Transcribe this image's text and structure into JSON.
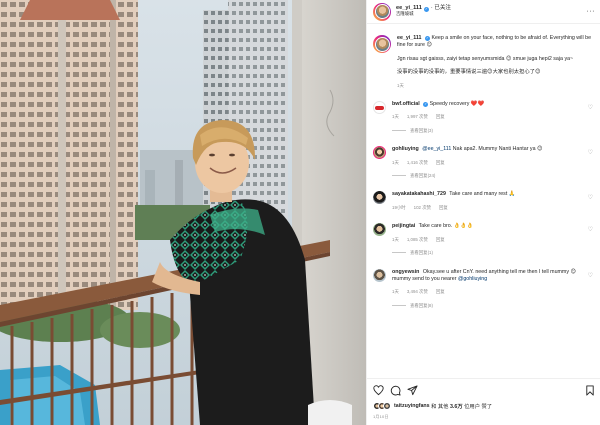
{
  "post": {
    "author": "ee_yi_111",
    "follow_label": "· 已关注",
    "location": "吉隆坡城"
  },
  "caption": {
    "username": "ee_yi_111",
    "text": "Keep a smile on your face, nothing to be afraid of. Everything will be fine for sure 😊",
    "malay": "Jgn risau sgt gaisss, zaiyi tetap senyumsmida 😊 smue juga hepi2 saja ya~",
    "chinese": "没事的没事的没事的，重要事情说三遍😊大家也别太担心了😊",
    "time": "1天"
  },
  "comments": [
    {
      "username": "bwf.official",
      "text": "Speedy recovery ❤️❤️",
      "time": "1天",
      "likes": "1,997 次赞",
      "reply_label": "回复",
      "view_replies": "查看回复(3)"
    },
    {
      "username": "gohliuying",
      "mention": "@ee_yi_111",
      "text": "Nak apa2. Mummy Nanti Hantar ya 😊",
      "time": "1天",
      "likes": "1,416 次赞",
      "reply_label": "回复",
      "view_replies": "查看回复(24)"
    },
    {
      "username": "sayakatakahashi_729",
      "text": "Take care and many rest 🙏",
      "time": "19小时",
      "likes": "102 次赞",
      "reply_label": "回复",
      "view_replies": ""
    },
    {
      "username": "peijingtai",
      "text": "Take care bro. 👌👌👌",
      "time": "1天",
      "likes": "1,085 次赞",
      "reply_label": "回复",
      "view_replies": "查看回复(1)"
    },
    {
      "username": "ongyewsin",
      "mention": "@gohliuying",
      "text": "Okay.see u after CnY. need anything tell me then I tell mummy 😊 mummy send to you nearer",
      "time": "1天",
      "likes": "3,494 次赞",
      "reply_label": "回复",
      "view_replies": "查看回复(8)"
    }
  ],
  "likes_summary": {
    "name": "taitzuyingfans",
    "and_label": "和 其他",
    "count": "3.6万",
    "suffix": "位用户 赞了"
  },
  "post_date": "1月10日",
  "colors": {
    "link": "#00376b",
    "muted": "#8e8e8e",
    "verified": "#3897f0",
    "story_ring_start": "#f9ce34",
    "story_ring_mid": "#ee2a7b",
    "story_ring_end": "#6228d7"
  },
  "icons": [
    "heart-icon",
    "comment-icon",
    "share-icon",
    "bookmark-icon",
    "more-icon",
    "verified-icon"
  ]
}
